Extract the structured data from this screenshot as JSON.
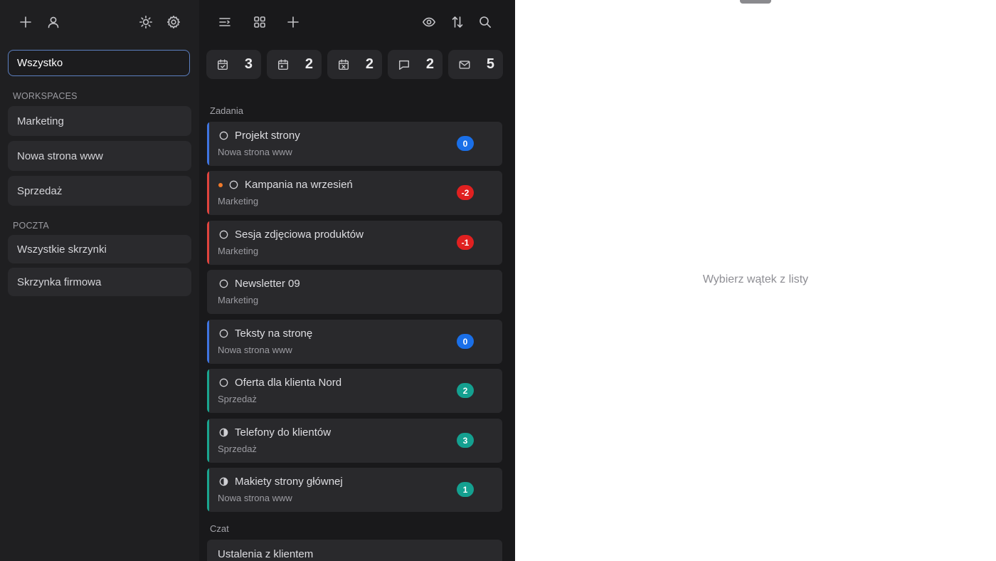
{
  "sidebar": {
    "toolbar": {
      "add_icon": "plus-icon",
      "user_icon": "user-icon",
      "theme_icon": "sun-icon",
      "settings_icon": "gear-icon"
    },
    "selected_filter": "Wszystko",
    "workspaces_title": "WORKSPACES",
    "workspaces": [
      {
        "label": "Marketing"
      },
      {
        "label": "Nowa strona www"
      },
      {
        "label": "Sprzedaż"
      }
    ],
    "mail_title": "POCZTA",
    "mailboxes": [
      {
        "label": "Wszystkie skrzynki"
      },
      {
        "label": "Skrzynka firmowa"
      }
    ]
  },
  "middle": {
    "toolbar": {
      "menu_icon": "list-filter-icon",
      "grid_icon": "grid-icon",
      "add_icon": "plus-icon",
      "view_icon": "eye-icon",
      "sort_icon": "sort-icon",
      "search_icon": "search-icon"
    },
    "stats": [
      {
        "icon": "calendar-check-icon",
        "count": "3"
      },
      {
        "icon": "calendar-icon",
        "count": "2"
      },
      {
        "icon": "calendar-x-icon",
        "count": "2"
      },
      {
        "icon": "chat-icon",
        "count": "2"
      },
      {
        "icon": "mail-icon",
        "count": "5"
      }
    ],
    "tasks_title": "Zadania",
    "tasks": [
      {
        "title": "Projekt strony",
        "workspace": "Nowa strona www",
        "badge": "0",
        "status": "open",
        "color": "#3f74e0",
        "badge_color": "#1a6fe8",
        "flag": false
      },
      {
        "title": "Kampania na wrzesień",
        "workspace": "Marketing",
        "badge": "-2",
        "status": "open",
        "color": "#e0443e",
        "badge_color": "#e02020",
        "flag": true,
        "flag_color": "#f07a2a"
      },
      {
        "title": "Sesja zdjęciowa produktów",
        "workspace": "Marketing",
        "badge": "-1",
        "status": "open",
        "color": "#e0443e",
        "badge_color": "#e02020",
        "flag": false
      },
      {
        "title": "Newsletter 09",
        "workspace": "Marketing",
        "badge": "",
        "status": "open",
        "color": "",
        "badge_color": "",
        "flag": false
      },
      {
        "title": "Teksty na stronę",
        "workspace": "Nowa strona www",
        "badge": "0",
        "status": "open",
        "color": "#3f74e0",
        "badge_color": "#1a6fe8",
        "flag": false
      },
      {
        "title": "Oferta dla klienta Nord",
        "workspace": "Sprzedaż",
        "badge": "2",
        "status": "open",
        "color": "#1aa58f",
        "badge_color": "#14a090",
        "flag": false
      },
      {
        "title": "Telefony do klientów",
        "workspace": "Sprzedaż",
        "badge": "3",
        "status": "in-progress",
        "color": "#1aa58f",
        "badge_color": "#14a090",
        "flag": false
      },
      {
        "title": "Makiety strony głównej",
        "workspace": "Nowa strona www",
        "badge": "1",
        "status": "in-progress",
        "color": "#1aa58f",
        "badge_color": "#14a090",
        "flag": false
      }
    ],
    "chat_title": "Czat",
    "chats": [
      {
        "title": "Ustalenia z klientem"
      }
    ]
  },
  "detail": {
    "empty_text": "Wybierz wątek z listy"
  }
}
